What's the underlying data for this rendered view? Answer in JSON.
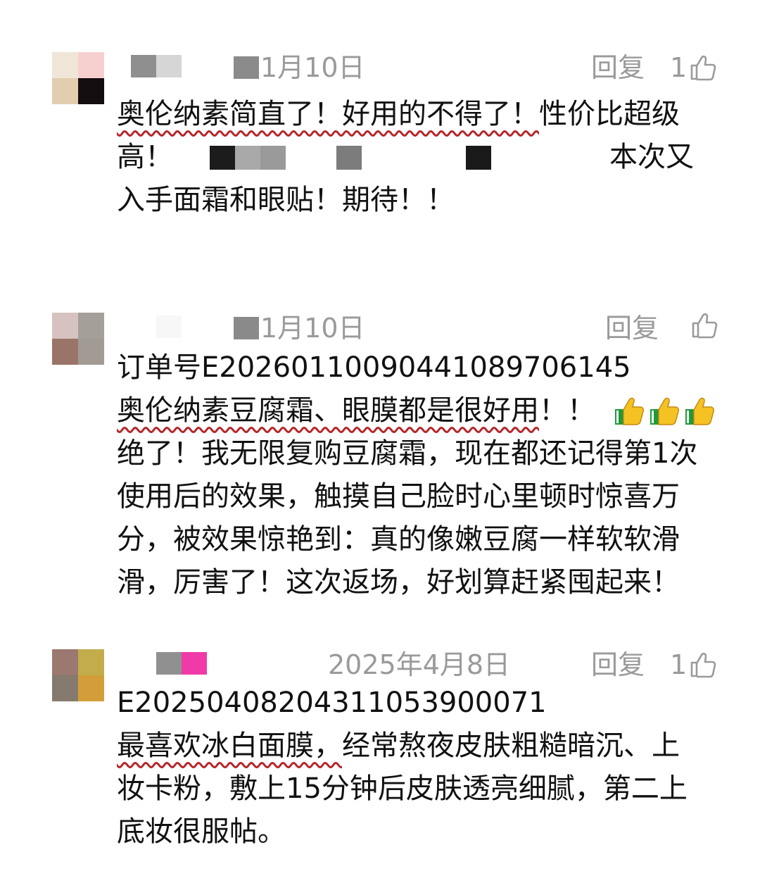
{
  "colors": {
    "text": "#111111",
    "meta": "#9a9a9a",
    "underline": "#b6262a",
    "thumb_yellow": "#f5c224",
    "thumb_green": "#1f9a3a"
  },
  "comments": [
    {
      "date": "1月10日",
      "reply_label": "回复",
      "like_count": "1",
      "lines": [
        {
          "hl": "奥伦纳素简直了！好用的不得了！",
          "rest": "性价比超级"
        },
        {
          "pre": "高！",
          "post": "本次又"
        },
        {
          "text": "入手面霜和眼贴！期待！！"
        }
      ]
    },
    {
      "date": "1月10日",
      "reply_label": "回复",
      "like_count": "",
      "lines": [
        {
          "text": "订单号E20260110090441089706145"
        },
        {
          "hl": "奥伦纳素豆腐霜、眼膜都是很好用",
          "rest": "！！"
        },
        {
          "text": "绝了！我无限复购豆腐霜，现在都还记得第1次"
        },
        {
          "text": "使用后的效果，触摸自己脸时心里顿时惊喜万"
        },
        {
          "text": "分，被效果惊艳到：真的像嫩豆腐一样软软滑"
        },
        {
          "text": "滑，厉害了！这次返场，好划算赶紧囤起来！"
        }
      ]
    },
    {
      "date": "2025年4月8日",
      "reply_label": "回复",
      "like_count": "1",
      "lines": [
        {
          "text": "E20250408204311053900071"
        },
        {
          "hl": "最喜欢冰白面膜，",
          "rest": "经常熬夜皮肤粗糙暗沉、上"
        },
        {
          "text": "妆卡粉，敷上15分钟后皮肤透亮细腻，第二上"
        },
        {
          "text": "底妆很服帖。"
        }
      ]
    }
  ],
  "icons": {
    "like": "thumbs-up-outline-icon",
    "emoji": "thumbs-up-emoji-icon"
  }
}
